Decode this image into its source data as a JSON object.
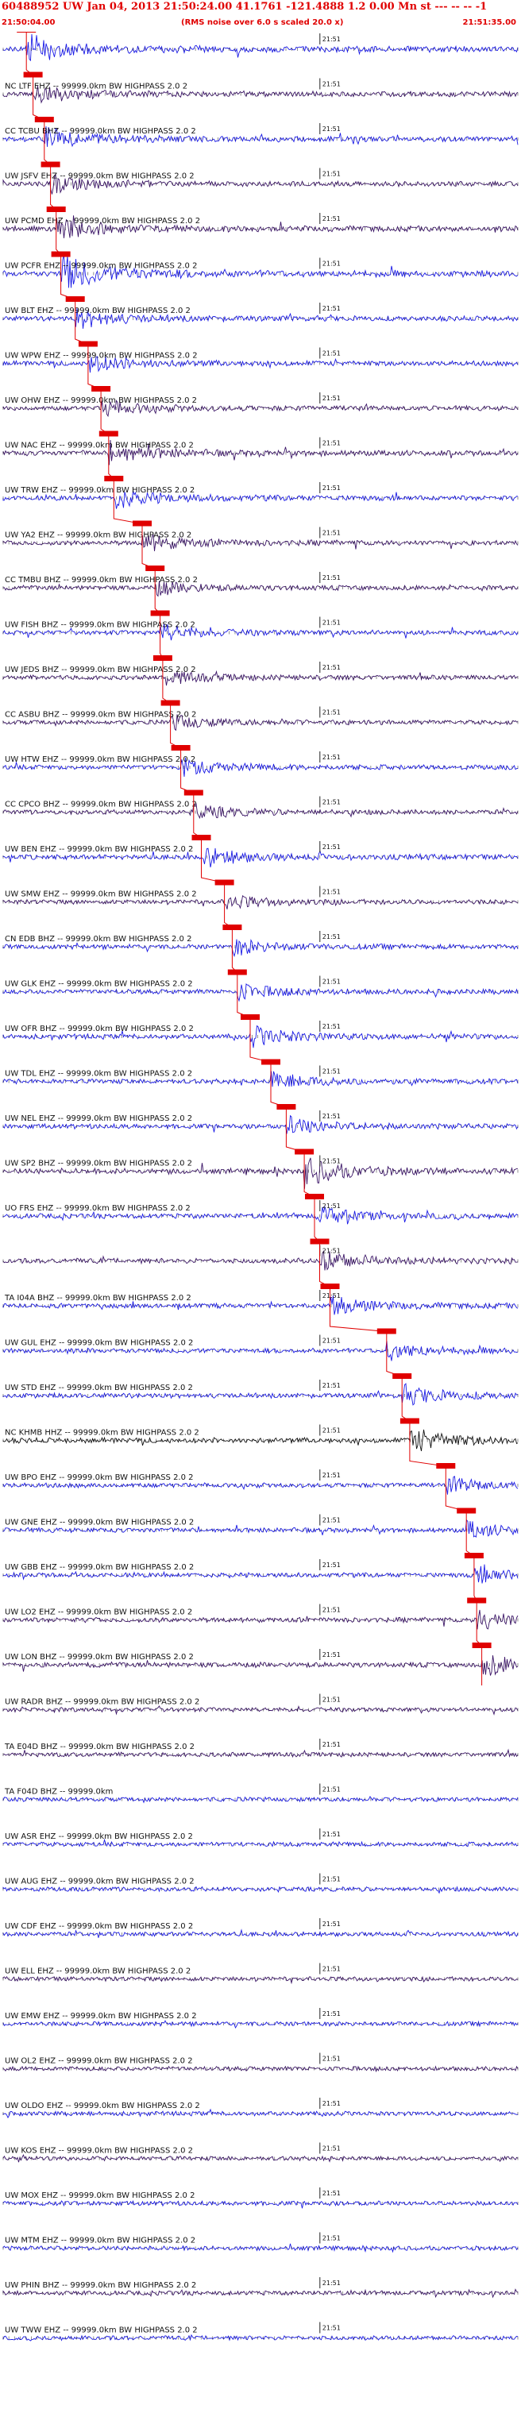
{
  "header": {
    "title": "60488952 UW Jan 04, 2013 21:50:24.00   41.1761 -121.4888  1.2 0.00 Mn st --- -- -- -1",
    "time_start": "21:50:04.00",
    "rms_note": "(RMS noise over 6.0 s scaled 20.0 x)",
    "time_end": "21:51:35.00"
  },
  "colors": {
    "header_text": "#e00000",
    "pick_marker": "#e00000",
    "trace_blue": "#1a1ae6",
    "trace_purple": "#3a1466",
    "trace_black": "#111111",
    "label_text": "#111111"
  },
  "chart_data": {
    "type": "seismogram_record_section",
    "time_range": [
      "21:50:04.00",
      "21:51:35.00"
    ],
    "minute_tick_label": "21:51",
    "channels": [
      {
        "label": "",
        "color": "blue",
        "pick": 0.045,
        "amp": 0.75
      },
      {
        "label": "NC LTF EHZ -- 99999.0km BW  HIGHPASS  2.0  2",
        "color": "purple",
        "pick": 0.058,
        "amp": 0.5
      },
      {
        "label": "CC TCBU BHZ -- 99999.0km BW  HIGHPASS  2.0  2",
        "color": "blue",
        "pick": 0.08,
        "amp": 0.55
      },
      {
        "label": "UW JSFV EHZ -- 99999.0km BW  HIGHPASS  2.0  2",
        "color": "purple",
        "pick": 0.092,
        "amp": 0.45
      },
      {
        "label": "UW PCMD EHZ -- 99999.0km BW  HIGHPASS  2.0  2",
        "color": "purple",
        "pick": 0.103,
        "amp": 0.6
      },
      {
        "label": "UW PCFR EHZ -- 99999.0km BW  HIGHPASS  2.0  2",
        "color": "blue",
        "pick": 0.112,
        "amp": 0.95
      },
      {
        "label": "UW BLT EHZ -- 99999.0km BW  HIGHPASS  2.0  2",
        "color": "blue",
        "pick": 0.14,
        "amp": 0.5
      },
      {
        "label": "UW WPW EHZ -- 99999.0km BW  HIGHPASS  2.0  2",
        "color": "blue",
        "pick": 0.165,
        "amp": 0.45
      },
      {
        "label": "UW OHW EHZ -- 99999.0km BW  HIGHPASS  2.0  2",
        "color": "purple",
        "pick": 0.19,
        "amp": 0.4
      },
      {
        "label": "UW NAC EHZ -- 99999.0km BW  HIGHPASS  2.0  2",
        "color": "purple",
        "pick": 0.205,
        "amp": 0.55
      },
      {
        "label": "UW TRW EHZ -- 99999.0km BW  HIGHPASS  2.0  2",
        "color": "blue",
        "pick": 0.215,
        "amp": 0.5
      },
      {
        "label": "UW YA2 EHZ -- 99999.0km BW  HIGHPASS  2.0  2",
        "color": "purple",
        "pick": 0.27,
        "amp": 0.45
      },
      {
        "label": "CC TMBU BHZ -- 99999.0km BW  HIGHPASS  2.0  2",
        "color": "purple",
        "pick": 0.295,
        "amp": 0.35
      },
      {
        "label": "UW FISH BHZ -- 99999.0km BW  HIGHPASS  2.0  2",
        "color": "blue",
        "pick": 0.305,
        "amp": 0.4
      },
      {
        "label": "UW JEDS BHZ -- 99999.0km BW  HIGHPASS  2.0  2",
        "color": "purple",
        "pick": 0.31,
        "amp": 0.35
      },
      {
        "label": "CC ASBU BHZ -- 99999.0km BW  HIGHPASS  2.0  2",
        "color": "purple",
        "pick": 0.325,
        "amp": 0.35
      },
      {
        "label": "UW HTW EHZ -- 99999.0km BW  HIGHPASS  2.0  2",
        "color": "blue",
        "pick": 0.345,
        "amp": 0.4
      },
      {
        "label": "CC CPCO BHZ -- 99999.0km BW  HIGHPASS  2.0  2",
        "color": "purple",
        "pick": 0.37,
        "amp": 0.35
      },
      {
        "label": "UW BEN EHZ -- 99999.0km BW  HIGHPASS  2.0  2",
        "color": "blue",
        "pick": 0.385,
        "amp": 0.5
      },
      {
        "label": "UW SMW EHZ -- 99999.0km BW  HIGHPASS  2.0  2",
        "color": "purple",
        "pick": 0.43,
        "amp": 0.35
      },
      {
        "label": "CN EDB BHZ -- 99999.0km BW  HIGHPASS  2.0  2",
        "color": "blue",
        "pick": 0.445,
        "amp": 0.4
      },
      {
        "label": "UW GLK EHZ -- 99999.0km BW  HIGHPASS  2.0  2",
        "color": "blue",
        "pick": 0.455,
        "amp": 0.4
      },
      {
        "label": "UW OFR BHZ -- 99999.0km BW  HIGHPASS  2.0  2",
        "color": "blue",
        "pick": 0.48,
        "amp": 0.5
      },
      {
        "label": "UW TDL EHZ -- 99999.0km BW  HIGHPASS  2.0  2",
        "color": "blue",
        "pick": 0.52,
        "amp": 0.45
      },
      {
        "label": "UW NEL EHZ -- 99999.0km BW  HIGHPASS  2.0  2",
        "color": "blue",
        "pick": 0.55,
        "amp": 0.45
      },
      {
        "label": "UW SP2 BHZ -- 99999.0km BW  HIGHPASS  2.0  2",
        "color": "purple",
        "pick": 0.585,
        "amp": 0.7
      },
      {
        "label": "UO FRS EHZ -- 99999.0km BW  HIGHPASS  2.0  2",
        "color": "blue",
        "pick": 0.605,
        "amp": 0.45
      },
      {
        "label": "",
        "color": "purple",
        "pick": 0.615,
        "amp": 0.55
      },
      {
        "label": "TA I04A BHZ -- 99999.0km BW  HIGHPASS  2.0  2",
        "color": "blue",
        "pick": 0.635,
        "amp": 0.45
      },
      {
        "label": "UW GUL EHZ -- 99999.0km BW  HIGHPASS  2.0  2",
        "color": "blue",
        "pick": 0.745,
        "amp": 0.45
      },
      {
        "label": "UW STD EHZ -- 99999.0km BW  HIGHPASS  2.0  2",
        "color": "blue",
        "pick": 0.775,
        "amp": 0.5
      },
      {
        "label": "NC KHMB HHZ -- 99999.0km BW  HIGHPASS  2.0  2",
        "color": "black",
        "pick": 0.79,
        "amp": 0.6
      },
      {
        "label": "UW BPO EHZ -- 99999.0km BW  HIGHPASS  2.0  2",
        "color": "blue",
        "pick": 0.86,
        "amp": 0.4
      },
      {
        "label": "UW GNE EHZ -- 99999.0km BW  HIGHPASS  2.0  2",
        "color": "blue",
        "pick": 0.9,
        "amp": 0.4
      },
      {
        "label": "UW GBB EHZ -- 99999.0km BW  HIGHPASS  2.0  2",
        "color": "blue",
        "pick": 0.915,
        "amp": 0.4
      },
      {
        "label": "UW LO2 EHZ -- 99999.0km BW  HIGHPASS  2.0  2",
        "color": "purple",
        "pick": 0.92,
        "amp": 0.5
      },
      {
        "label": "UW LON BHZ -- 99999.0km BW  HIGHPASS  2.0  2",
        "color": "purple",
        "pick": 0.93,
        "amp": 0.55
      },
      {
        "label": "UW RADR BHZ -- 99999.0km BW  HIGHPASS  2.0  2",
        "color": "purple",
        "pick": null,
        "amp": 0.3
      },
      {
        "label": "TA E04D BHZ -- 99999.0km BW  HIGHPASS  2.0  2",
        "color": "purple",
        "pick": null,
        "amp": 0.3
      },
      {
        "label": "TA F04D BHZ -- 99999.0km",
        "color": "blue",
        "pick": null,
        "amp": 0.3
      },
      {
        "label": "UW ASR EHZ -- 99999.0km BW  HIGHPASS  2.0  2",
        "color": "blue",
        "pick": null,
        "amp": 0.35
      },
      {
        "label": "UW AUG EHZ -- 99999.0km BW  HIGHPASS  2.0  2",
        "color": "blue",
        "pick": null,
        "amp": 0.3
      },
      {
        "label": "UW CDF EHZ -- 99999.0km BW  HIGHPASS  2.0  2",
        "color": "blue",
        "pick": null,
        "amp": 0.3
      },
      {
        "label": "UW ELL EHZ -- 99999.0km BW  HIGHPASS  2.0  2",
        "color": "purple",
        "pick": null,
        "amp": 0.3
      },
      {
        "label": "UW EMW EHZ -- 99999.0km BW  HIGHPASS  2.0  2",
        "color": "blue",
        "pick": null,
        "amp": 0.3
      },
      {
        "label": "UW OL2 EHZ -- 99999.0km BW  HIGHPASS  2.0  2",
        "color": "purple",
        "pick": null,
        "amp": 0.3
      },
      {
        "label": "UW OLDO EHZ -- 99999.0km BW  HIGHPASS  2.0  2",
        "color": "blue",
        "pick": null,
        "amp": 0.3
      },
      {
        "label": "UW KOS EHZ -- 99999.0km BW  HIGHPASS  2.0  2",
        "color": "purple",
        "pick": null,
        "amp": 0.3
      },
      {
        "label": "UW MOX EHZ -- 99999.0km BW  HIGHPASS  2.0  2",
        "color": "blue",
        "pick": null,
        "amp": 0.35
      },
      {
        "label": "UW MTM EHZ -- 99999.0km BW  HIGHPASS  2.0  2",
        "color": "blue",
        "pick": null,
        "amp": 0.3
      },
      {
        "label": "UW PHIN BHZ -- 99999.0km BW  HIGHPASS  2.0  2",
        "color": "purple",
        "pick": null,
        "amp": 0.3
      },
      {
        "label": "UW TWW EHZ -- 99999.0km BW  HIGHPASS  2.0  2",
        "color": "blue",
        "pick": null,
        "amp": 0.3
      }
    ]
  }
}
